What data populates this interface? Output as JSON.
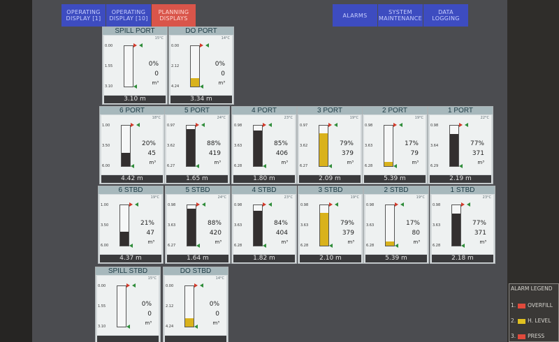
{
  "nav": {
    "operating1": "OPERATING\nDISPLAY [1]",
    "operating10": "OPERATING\nDISPLAY [10]",
    "planning": "PLANNING\nDISPLAYS",
    "alarms": "ALARMS",
    "system_maintenance": "SYSTEM\nMAINTENANCE",
    "data_logging": "DATA\nLOGGING"
  },
  "colors": {
    "fill_dark": "#332f2f",
    "fill_yellow": "#d9b21c",
    "active_tab": "#d9554a",
    "nav_button": "#3d4cc0"
  },
  "tanks": [
    {
      "name": "SPILL PORT",
      "temp": "15°C",
      "top": "0.00",
      "mid": "1.55",
      "bot": "3.10",
      "pct": "0%",
      "vol": "0",
      "unit": "m³",
      "level": "3.10 m",
      "fill_fraction": 0,
      "fill_color": "dark"
    },
    {
      "name": "DO PORT",
      "temp": "14°C",
      "top": "0.00",
      "mid": "2.12",
      "bot": "4.24",
      "pct": "0%",
      "vol": "0",
      "unit": "m³",
      "level": "3.34 m",
      "fill_fraction": 0.2,
      "fill_color": "yellow"
    },
    {
      "name": "6 PORT",
      "temp": "18°C",
      "top": "1.00",
      "mid": "3.50",
      "bot": "6.00",
      "pct": "20%",
      "vol": "45",
      "unit": "m³",
      "level": "4.42 m",
      "fill_fraction": 0.32,
      "fill_color": "dark"
    },
    {
      "name": "5 PORT",
      "temp": "24°C",
      "top": "0.97",
      "mid": "3.62",
      "bot": "6.27",
      "pct": "88%",
      "vol": "419",
      "unit": "m³",
      "level": "1.65 m",
      "fill_fraction": 0.88,
      "fill_color": "dark"
    },
    {
      "name": "4 PORT",
      "temp": "23°C",
      "top": "0.98",
      "mid": "3.63",
      "bot": "6.28",
      "pct": "85%",
      "vol": "406",
      "unit": "m³",
      "level": "1.80 m",
      "fill_fraction": 0.85,
      "fill_color": "dark"
    },
    {
      "name": "3 PORT",
      "temp": "19°C",
      "top": "0.97",
      "mid": "3.62",
      "bot": "6.27",
      "pct": "79%",
      "vol": "379",
      "unit": "m³",
      "level": "2.09 m",
      "fill_fraction": 0.79,
      "fill_color": "yellow"
    },
    {
      "name": "2 PORT",
      "temp": "19°C",
      "top": "0.98",
      "mid": "3.63",
      "bot": "6.28",
      "pct": "17%",
      "vol": "79",
      "unit": "m³",
      "level": "5.39 m",
      "fill_fraction": 0.1,
      "fill_color": "yellow"
    },
    {
      "name": "1 PORT",
      "temp": "22°C",
      "top": "0.98",
      "mid": "3.64",
      "bot": "6.29",
      "pct": "77%",
      "vol": "371",
      "unit": "m³",
      "level": "2.19 m",
      "fill_fraction": 0.77,
      "fill_color": "dark"
    },
    {
      "name": "6 STBD",
      "temp": "19°C",
      "top": "1.00",
      "mid": "3.50",
      "bot": "6.00",
      "pct": "21%",
      "vol": "47",
      "unit": "m³",
      "level": "4.37 m",
      "fill_fraction": 0.33,
      "fill_color": "dark"
    },
    {
      "name": "5 STBD",
      "temp": "24°C",
      "top": "0.98",
      "mid": "3.63",
      "bot": "6.27",
      "pct": "88%",
      "vol": "420",
      "unit": "m³",
      "level": "1.64 m",
      "fill_fraction": 0.88,
      "fill_color": "dark"
    },
    {
      "name": "4 STBD",
      "temp": "23°C",
      "top": "0.98",
      "mid": "3.63",
      "bot": "6.28",
      "pct": "84%",
      "vol": "404",
      "unit": "m³",
      "level": "1.82 m",
      "fill_fraction": 0.84,
      "fill_color": "dark"
    },
    {
      "name": "3 STBD",
      "temp": "19°C",
      "top": "0.98",
      "mid": "3.63",
      "bot": "6.28",
      "pct": "79%",
      "vol": "379",
      "unit": "m³",
      "level": "2.10 m",
      "fill_fraction": 0.79,
      "fill_color": "yellow"
    },
    {
      "name": "2 STBD",
      "temp": "19°C",
      "top": "0.98",
      "mid": "3.63",
      "bot": "6.28",
      "pct": "17%",
      "vol": "80",
      "unit": "m³",
      "level": "5.39 m",
      "fill_fraction": 0.1,
      "fill_color": "yellow"
    },
    {
      "name": "1 STBD",
      "temp": "23°C",
      "top": "0.98",
      "mid": "3.63",
      "bot": "6.28",
      "pct": "77%",
      "vol": "371",
      "unit": "m³",
      "level": "2.18 m",
      "fill_fraction": 0.77,
      "fill_color": "dark"
    },
    {
      "name": "SPILL STBD",
      "temp": "15°C",
      "top": "0.00",
      "mid": "1.55",
      "bot": "3.10",
      "pct": "0%",
      "vol": "0",
      "unit": "m³",
      "level": "",
      "fill_fraction": 0,
      "fill_color": "dark"
    },
    {
      "name": "DO STBD",
      "temp": "14°C",
      "top": "0.00",
      "mid": "2.12",
      "bot": "4.24",
      "pct": "0%",
      "vol": "0",
      "unit": "m³",
      "level": "",
      "fill_fraction": 0.2,
      "fill_color": "yellow"
    }
  ],
  "legend": {
    "title": "ALARM LEGEND",
    "items": [
      {
        "num": "1.",
        "label": "OVERFILL",
        "color": "#e04a3c"
      },
      {
        "num": "2.",
        "label": "H. LEVEL",
        "color": "#e0c020"
      },
      {
        "num": "3.",
        "label": "PRESS",
        "color": "#e04a3c"
      }
    ]
  }
}
